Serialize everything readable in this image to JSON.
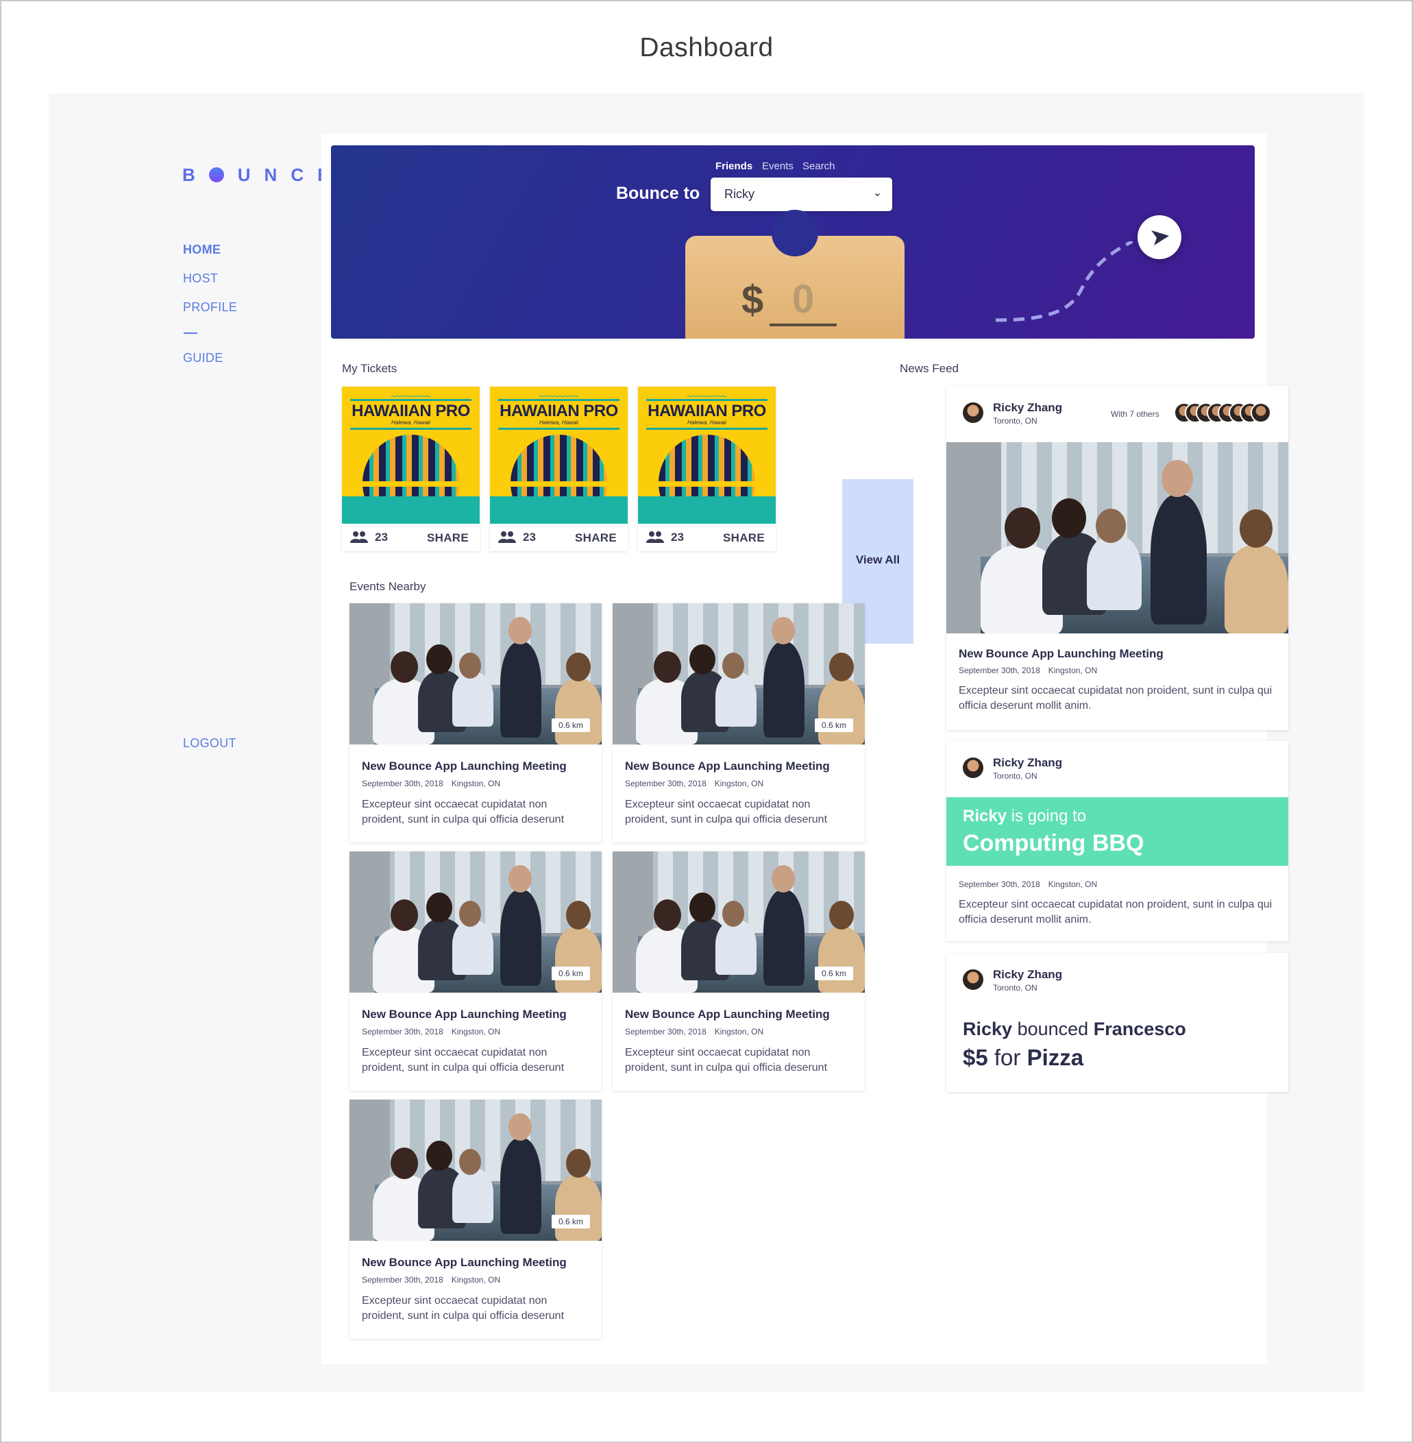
{
  "page_title": "Dashboard",
  "brand": {
    "logo": "B  UNCE",
    "accent": "#5b7ce0"
  },
  "sidebar": {
    "items": [
      {
        "label": "HOME",
        "active": true
      },
      {
        "label": "HOST"
      },
      {
        "label": "PROFILE"
      },
      {
        "label": "GUIDE"
      }
    ],
    "logout": "LOGOUT"
  },
  "hero": {
    "tabs": [
      "Friends",
      "Events",
      "Search"
    ],
    "active_tab": "Friends",
    "bounce_to_label": "Bounce to",
    "recipient": "Ricky",
    "currency": "$",
    "amount": "0",
    "send_icon": "paper-plane-icon"
  },
  "my_tickets": {
    "heading": "My Tickets",
    "tickets": [
      {
        "title": "HAWAIIAN PRO",
        "subtitle": "Haleiwa, Hawaii",
        "count": "23",
        "share": "SHARE"
      },
      {
        "title": "HAWAIIAN PRO",
        "subtitle": "Haleiwa, Hawaii",
        "count": "23",
        "share": "SHARE"
      },
      {
        "title": "HAWAIIAN PRO",
        "subtitle": "Haleiwa, Hawaii",
        "count": "23",
        "share": "SHARE"
      }
    ],
    "view_all": "View All"
  },
  "events_nearby": {
    "heading": "Events Nearby",
    "events": [
      {
        "title": "New Bounce App Launching Meeting",
        "date": "September 30th, 2018",
        "location": "Kingston, ON",
        "distance": "0.6 km",
        "desc": "Excepteur sint occaecat cupidatat non proident, sunt in culpa qui officia deserunt"
      },
      {
        "title": "New Bounce App Launching Meeting",
        "date": "September 30th, 2018",
        "location": "Kingston, ON",
        "distance": "0.6 km",
        "desc": "Excepteur sint occaecat cupidatat non proident, sunt in culpa qui officia deserunt"
      },
      {
        "title": "New Bounce App Launching Meeting",
        "date": "September 30th, 2018",
        "location": "Kingston, ON",
        "distance": "0.6 km",
        "desc": "Excepteur sint occaecat cupidatat non proident, sunt in culpa qui officia deserunt"
      },
      {
        "title": "New Bounce App Launching Meeting",
        "date": "September 30th, 2018",
        "location": "Kingston, ON",
        "distance": "0.6 km",
        "desc": "Excepteur sint occaecat cupidatat non proident, sunt in culpa qui officia deserunt"
      },
      {
        "title": "New Bounce App Launching Meeting",
        "date": "September 30th, 2018",
        "location": "Kingston, ON",
        "distance": "0.6 km",
        "desc": "Excepteur sint occaecat cupidatat non proident, sunt in culpa qui officia deserunt"
      }
    ]
  },
  "news_feed": {
    "heading": "News Feed",
    "posts": [
      {
        "user": "Ricky Zhang",
        "location": "Toronto, ON",
        "with": "With 7 others",
        "title": "New Bounce App Launching Meeting",
        "date": "September 30th, 2018",
        "event_location": "Kingston, ON",
        "desc": "Excepteur sint occaecat cupidatat non proident, sunt in culpa qui officia deserunt mollit anim."
      },
      {
        "user": "Ricky Zhang",
        "location": "Toronto, ON",
        "going_name": "Ricky",
        "going_text": "is going to",
        "going_event": "Computing BBQ",
        "date": "September 30th, 2018",
        "event_location": "Kingston, ON",
        "desc": "Excepteur sint occaecat cupidatat non proident, sunt in culpa qui officia deserunt mollit anim."
      },
      {
        "user": "Ricky Zhang",
        "location": "Toronto, ON",
        "from": "Ricky",
        "verb": "bounced",
        "to": "Francesco",
        "amount": "$5",
        "for": "for",
        "item": "Pizza"
      }
    ]
  }
}
